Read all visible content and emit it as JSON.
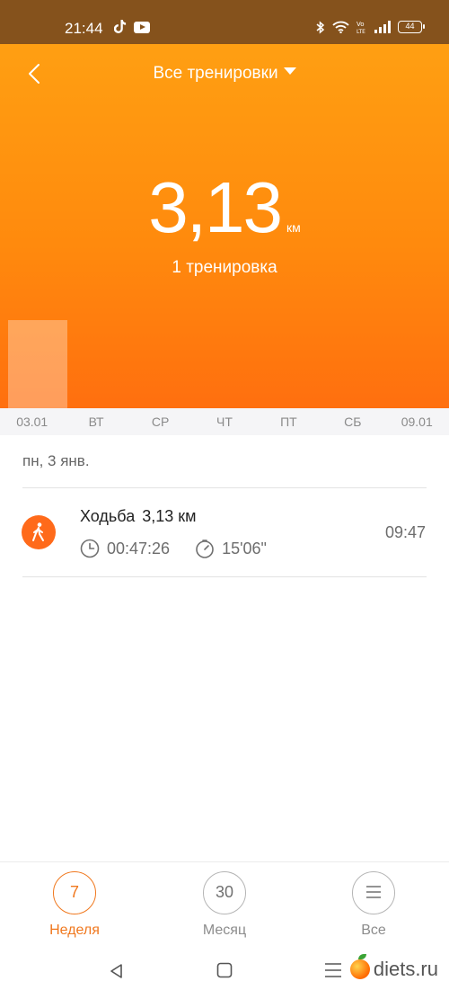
{
  "status_bar": {
    "time": "21:44",
    "left_icons": [
      "tiktok-icon",
      "youtube-icon"
    ],
    "right_icons": [
      "bluetooth-icon",
      "wifi-icon",
      "volte-icon",
      "signal-icon",
      "battery-icon"
    ],
    "volte_label": "Vo\nLTE",
    "battery_level": "44"
  },
  "header": {
    "filter_label": "Все тренировки",
    "back_icon": "chevron-left-icon"
  },
  "summary": {
    "distance_value": "3,13",
    "distance_unit": "км",
    "workouts_label": "1 тренировка"
  },
  "chart_data": {
    "type": "bar",
    "categories": [
      "03.01",
      "ВТ",
      "СР",
      "ЧТ",
      "ПТ",
      "СБ",
      "09.01"
    ],
    "values": [
      3.13,
      0,
      0,
      0,
      0,
      0,
      0
    ]
  },
  "section": {
    "date_label": "пн, 3 янв."
  },
  "workout": {
    "type_label": "Ходьба",
    "distance": "3,13 км",
    "duration": "00:47:26",
    "pace": "15'06\"",
    "time": "09:47",
    "icon": "walking-icon",
    "accent_color": "#ff6a1a"
  },
  "bottom_nav": {
    "items": [
      {
        "number": "7",
        "label": "Неделя",
        "active": true
      },
      {
        "number": "30",
        "label": "Месяц",
        "active": false
      },
      {
        "icon": "list-icon",
        "label": "Все",
        "active": false
      }
    ],
    "active_color": "#f0781e"
  },
  "watermark": {
    "text": "diets.ru"
  }
}
